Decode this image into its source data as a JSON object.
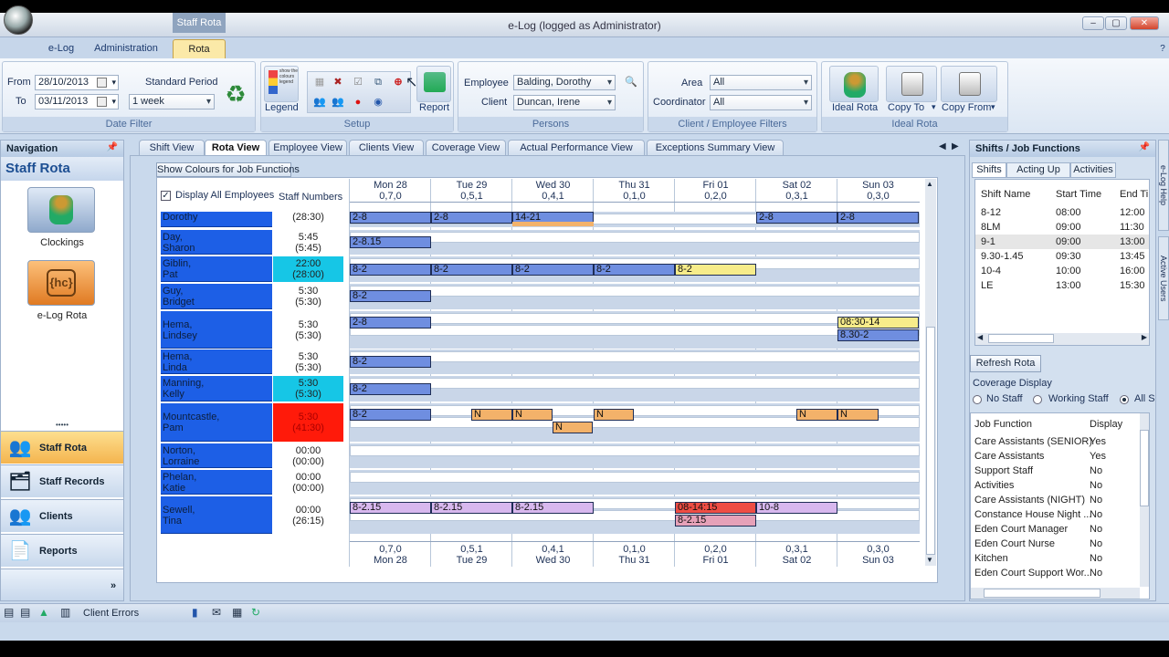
{
  "window": {
    "title": "e-Log (logged as Administrator)",
    "context_tab": "Staff Rota",
    "min": "–",
    "max": "▢",
    "close": "✕"
  },
  "tabs": [
    "e-Log",
    "Administration",
    "Rota"
  ],
  "ribbon": {
    "date_filter": {
      "from_label": "From",
      "to_label": "To",
      "from": "28/10/2013",
      "to": "03/11/2013",
      "period_label": "Standard Period",
      "period": "1 week",
      "caption": "Date Filter"
    },
    "setup": {
      "legend_label": "Legend",
      "legend_small": "show the colours legend",
      "report_label": "Report",
      "caption": "Setup"
    },
    "persons": {
      "employee_label": "Employee",
      "employee": "Balding, Dorothy",
      "client_label": "Client",
      "client": "Duncan, Irene",
      "caption": "Persons"
    },
    "filters": {
      "area_label": "Area",
      "area": "All",
      "coordinator_label": "Coordinator",
      "coordinator": "All",
      "caption": "Client / Employee Filters"
    },
    "ideal": {
      "ideal_rota": "Ideal Rota",
      "copy_to": "Copy To",
      "copy_from": "Copy From",
      "caption": "Ideal Rota"
    }
  },
  "nav": {
    "header": "Navigation",
    "title": "Staff Rota",
    "big_items": [
      "Clockings",
      "e-Log Rota"
    ],
    "items": [
      "Staff Rota",
      "Staff Records",
      "Clients",
      "Reports"
    ],
    "dots": "•••••",
    "more": "»"
  },
  "view_tabs": [
    "Shift View",
    "Rota View",
    "Employee View",
    "Clients View",
    "Coverage View",
    "Actual Performance View",
    "Exceptions Summary View"
  ],
  "grid": {
    "colors_button": "Show Colours for Job Functions",
    "display_all_label": "Display All Employees",
    "check": "✓",
    "staff_numbers_label": "Staff Numbers",
    "days": [
      {
        "name": "Mon 28",
        "num": "0,7,0"
      },
      {
        "name": "Tue 29",
        "num": "0,5,1"
      },
      {
        "name": "Wed 30",
        "num": "0,4,1"
      },
      {
        "name": "Thu 31",
        "num": "0,1,0"
      },
      {
        "name": "Fri 01",
        "num": "0,2,0"
      },
      {
        "name": "Sat 02",
        "num": "0,3,1"
      },
      {
        "name": "Sun 03",
        "num": "0,3,0"
      }
    ],
    "employees": [
      {
        "l1": "",
        "l2": "Dorothy",
        "n1": "",
        "n2": "(28:30)"
      },
      {
        "l1": "Day,",
        "l2": "Sharon",
        "n1": "5:45",
        "n2": "(5:45)"
      },
      {
        "l1": "Giblin,",
        "l2": "Pat",
        "n1": "22:00",
        "n2": "(28:00)"
      },
      {
        "l1": "Guy,",
        "l2": "Bridget",
        "n1": "5:30",
        "n2": "(5:30)"
      },
      {
        "l1": "Hema,",
        "l2": "Lindsey",
        "n1": "5:30",
        "n2": "(5:30)"
      },
      {
        "l1": "Hema,",
        "l2": "Linda",
        "n1": "5:30",
        "n2": "(5:30)"
      },
      {
        "l1": "Manning,",
        "l2": "Kelly",
        "n1": "5:30",
        "n2": "(5:30)"
      },
      {
        "l1": "Mountcastle,",
        "l2": "Pam",
        "n1": "5:30",
        "n2": "(41:30)"
      },
      {
        "l1": "Norton,",
        "l2": "Lorraine",
        "n1": "00:00",
        "n2": "(00:00)"
      },
      {
        "l1": "Phelan,",
        "l2": "Katie",
        "n1": "00:00",
        "n2": "(00:00)"
      },
      {
        "l1": "Sewell,",
        "l2": "Tina",
        "n1": "00:00",
        "n2": "(26:15)"
      }
    ],
    "shifts": {
      "s28": "2-8",
      "s815": "2-8.15",
      "s82": "8-2",
      "s1421": "14-21",
      "n": "N",
      "s830_14": "08:30-14",
      "s830_2": "8.30-2",
      "s8215": "8-2.15",
      "s08_1415": "08-14:15",
      "s108": "10-8"
    },
    "colors": {
      "emp_blue": "#1d5fe6",
      "shift_blue": "#6f8ee0",
      "shift_orange": "#f3b26a",
      "shift_yellow": "#f7ec8a",
      "shift_lilac": "#d8b8ee",
      "shift_red": "#ee4d44",
      "shift_pink": "#e6a1b8",
      "cyan": "#16c6e6",
      "red": "#ff1a0a"
    }
  },
  "right": {
    "header": "Shifts / Job Functions",
    "tabs": [
      "Shifts",
      "Acting Up",
      "Activities"
    ],
    "cols": [
      "Shift Name",
      "Start Time",
      "End Ti"
    ],
    "shifts": [
      [
        "8-12",
        "08:00",
        "12:00"
      ],
      [
        "8LM",
        "09:00",
        "11:30"
      ],
      [
        "9-1",
        "09:00",
        "13:00"
      ],
      [
        "9.30-1.45",
        "09:30",
        "13:45"
      ],
      [
        "10-4",
        "10:00",
        "16:00"
      ],
      [
        "LE",
        "13:00",
        "15:30"
      ]
    ],
    "refresh": "Refresh Rota",
    "coverage_label": "Coverage Display",
    "radios": [
      "No Staff",
      "Working Staff",
      "All S"
    ],
    "jf_cols": [
      "Job Function",
      "Display"
    ],
    "jobs": [
      [
        "Care Assistants (SENIOR)",
        "Yes"
      ],
      [
        "Care Assistants",
        "Yes"
      ],
      [
        "Support Staff",
        "No"
      ],
      [
        "Activities",
        "No"
      ],
      [
        "Care Assistants (NIGHT)",
        "No"
      ],
      [
        "Constance House Night ...",
        "No"
      ],
      [
        "Eden Court Manager",
        "No"
      ],
      [
        "Eden Court Nurse",
        "No"
      ],
      [
        "Kitchen",
        "No"
      ],
      [
        "Eden Court Support Wor...",
        "No"
      ]
    ],
    "side_tabs": [
      "e-Log Help",
      "Active Users"
    ]
  },
  "status": {
    "client_errors": "Client Errors"
  }
}
